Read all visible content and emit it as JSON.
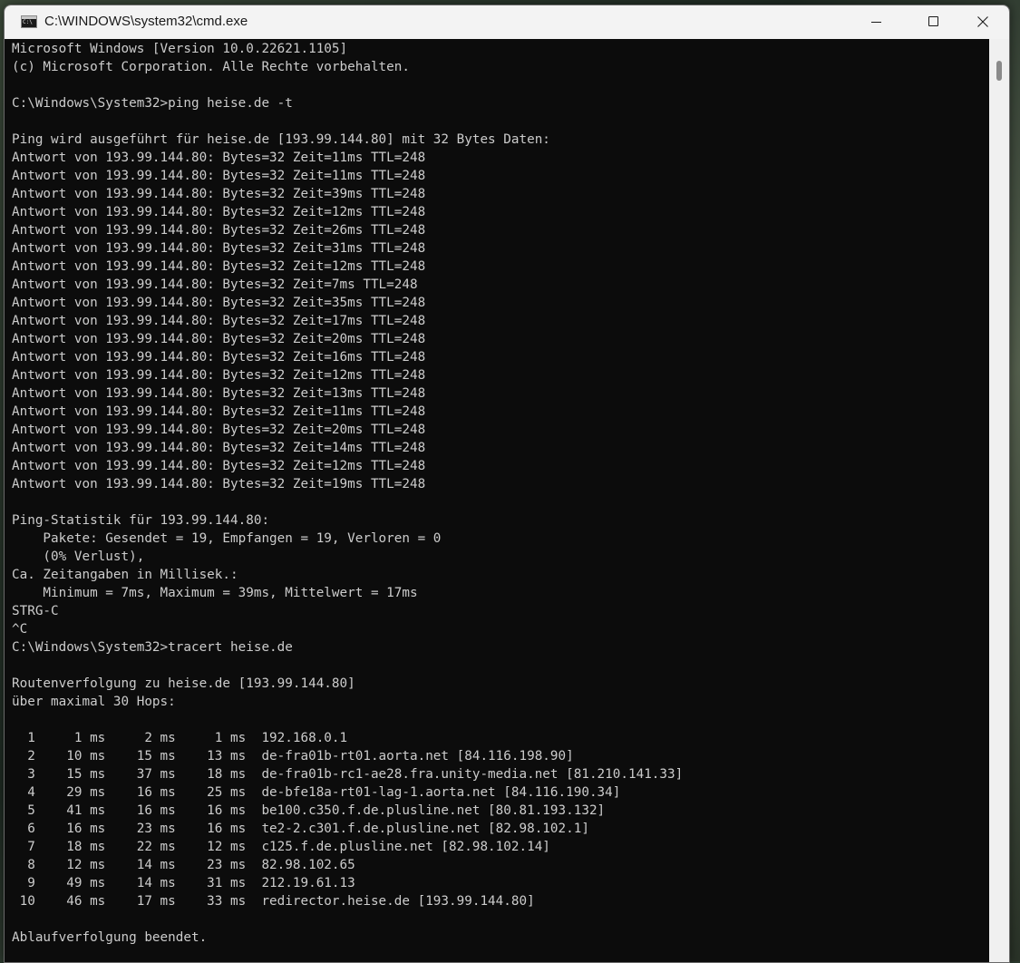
{
  "window": {
    "title": "C:\\WINDOWS\\system32\\cmd.exe",
    "app_icon": "cmd-icon",
    "buttons": {
      "minimize_icon": "minimize-icon",
      "maximize_icon": "maximize-icon",
      "close_icon": "close-icon"
    }
  },
  "colors": {
    "console_background": "#0c0c0c",
    "console_text": "#cccccc",
    "titlebar_background": "#f3f3f3"
  },
  "console": {
    "lines": [
      "Microsoft Windows [Version 10.0.22621.1105]",
      "(c) Microsoft Corporation. Alle Rechte vorbehalten.",
      "",
      "C:\\Windows\\System32>ping heise.de -t",
      "",
      "Ping wird ausgeführt für heise.de [193.99.144.80] mit 32 Bytes Daten:",
      "Antwort von 193.99.144.80: Bytes=32 Zeit=11ms TTL=248",
      "Antwort von 193.99.144.80: Bytes=32 Zeit=11ms TTL=248",
      "Antwort von 193.99.144.80: Bytes=32 Zeit=39ms TTL=248",
      "Antwort von 193.99.144.80: Bytes=32 Zeit=12ms TTL=248",
      "Antwort von 193.99.144.80: Bytes=32 Zeit=26ms TTL=248",
      "Antwort von 193.99.144.80: Bytes=32 Zeit=31ms TTL=248",
      "Antwort von 193.99.144.80: Bytes=32 Zeit=12ms TTL=248",
      "Antwort von 193.99.144.80: Bytes=32 Zeit=7ms TTL=248",
      "Antwort von 193.99.144.80: Bytes=32 Zeit=35ms TTL=248",
      "Antwort von 193.99.144.80: Bytes=32 Zeit=17ms TTL=248",
      "Antwort von 193.99.144.80: Bytes=32 Zeit=20ms TTL=248",
      "Antwort von 193.99.144.80: Bytes=32 Zeit=16ms TTL=248",
      "Antwort von 193.99.144.80: Bytes=32 Zeit=12ms TTL=248",
      "Antwort von 193.99.144.80: Bytes=32 Zeit=13ms TTL=248",
      "Antwort von 193.99.144.80: Bytes=32 Zeit=11ms TTL=248",
      "Antwort von 193.99.144.80: Bytes=32 Zeit=20ms TTL=248",
      "Antwort von 193.99.144.80: Bytes=32 Zeit=14ms TTL=248",
      "Antwort von 193.99.144.80: Bytes=32 Zeit=12ms TTL=248",
      "Antwort von 193.99.144.80: Bytes=32 Zeit=19ms TTL=248",
      "",
      "Ping-Statistik für 193.99.144.80:",
      "    Pakete: Gesendet = 19, Empfangen = 19, Verloren = 0",
      "    (0% Verlust),",
      "Ca. Zeitangaben in Millisek.:",
      "    Minimum = 7ms, Maximum = 39ms, Mittelwert = 17ms",
      "STRG-C",
      "^C",
      "C:\\Windows\\System32>tracert heise.de",
      "",
      "Routenverfolgung zu heise.de [193.99.144.80]",
      "über maximal 30 Hops:",
      "",
      "  1     1 ms     2 ms     1 ms  192.168.0.1",
      "  2    10 ms    15 ms    13 ms  de-fra01b-rt01.aorta.net [84.116.198.90]",
      "  3    15 ms    37 ms    18 ms  de-fra01b-rc1-ae28.fra.unity-media.net [81.210.141.33]",
      "  4    29 ms    16 ms    25 ms  de-bfe18a-rt01-lag-1.aorta.net [84.116.190.34]",
      "  5    41 ms    16 ms    16 ms  be100.c350.f.de.plusline.net [80.81.193.132]",
      "  6    16 ms    23 ms    16 ms  te2-2.c301.f.de.plusline.net [82.98.102.1]",
      "  7    18 ms    22 ms    12 ms  c125.f.de.plusline.net [82.98.102.14]",
      "  8    12 ms    14 ms    23 ms  82.98.102.65",
      "  9    49 ms    14 ms    31 ms  212.19.61.13",
      " 10    46 ms    17 ms    33 ms  redirector.heise.de [193.99.144.80]",
      "",
      "Ablaufverfolgung beendet."
    ]
  }
}
